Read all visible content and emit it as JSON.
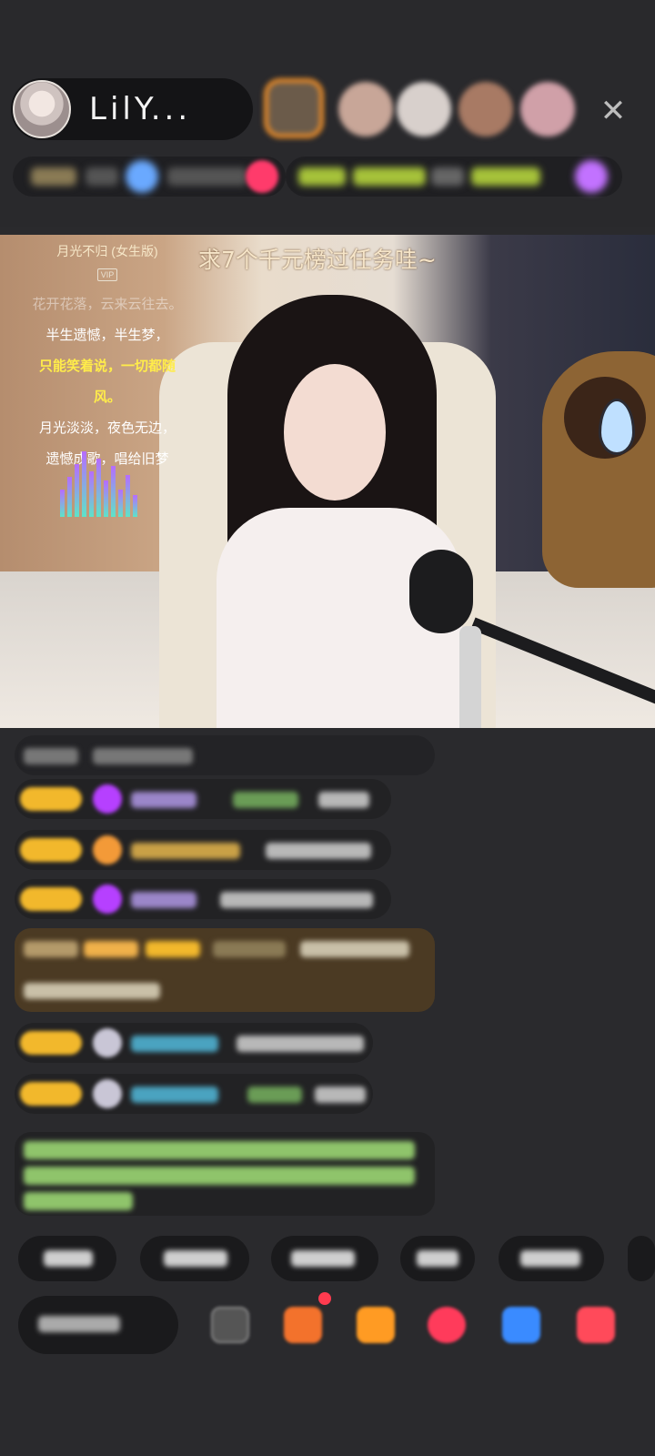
{
  "header": {
    "host_name": "LilY...",
    "close_icon": "close-icon",
    "viewer_avatars": [
      "viewer-avatar-1",
      "viewer-avatar-2",
      "viewer-avatar-3",
      "viewer-avatar-4",
      "viewer-avatar-5"
    ]
  },
  "video": {
    "caption": "求7个千元榜过任务哇~",
    "lyrics": {
      "title": "月光不归 (女生版)",
      "tag": "VIP",
      "lines": [
        "花开花落，云来云往去。",
        "半生遗憾，半生梦，",
        "只能笑着说，一切都随风。",
        "月光淡淡，夜色无边，",
        "遗憾成歌，唱给旧梦"
      ],
      "highlighted_line_index": 2
    }
  },
  "colors": {
    "background": "#2a2a2d",
    "badge_gold": "#f2b82c",
    "accent_green": "#8fc46b",
    "accent_purple": "#b66cff",
    "caption": "#f6e5c8"
  }
}
